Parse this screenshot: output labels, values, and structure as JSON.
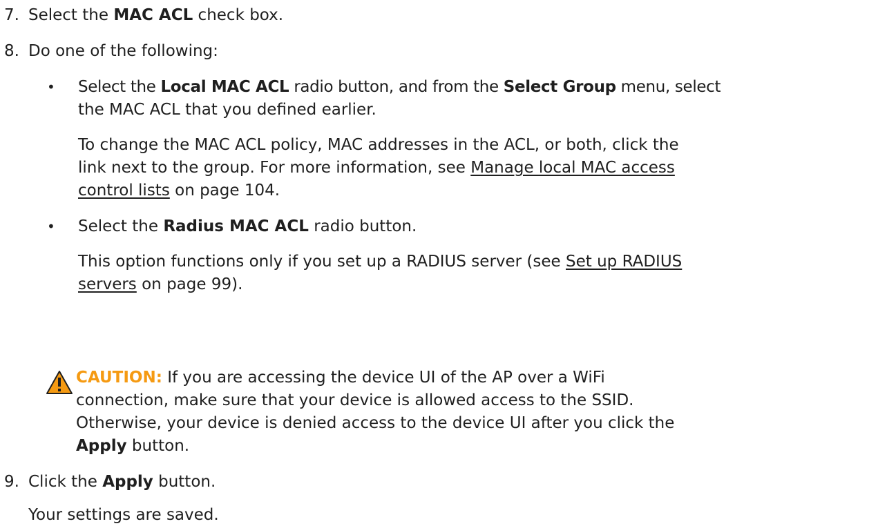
{
  "step7": {
    "number": "7.",
    "pre": "Select the ",
    "bold": "MAC ACL",
    "post": " check box."
  },
  "step8": {
    "number": "8.",
    "text": "Do one of the following:"
  },
  "option1": {
    "bullet": "•",
    "pre": "Select the ",
    "bold1": "Local MAC ACL",
    "mid": " radio button, and from the ",
    "bold2": "Select Group",
    "post": " menu, select",
    "line2": "the MAC ACL that you defined earlier.",
    "para_l1": "To change the MAC ACL policy, MAC addresses in the ACL, or both, click the",
    "para_l2_pre": "link next to the group. For more information, see ",
    "link_part1": "Manage local MAC access",
    "link_part2": "control lists",
    "para_l3_post": " on page 104."
  },
  "option2": {
    "bullet": "•",
    "pre": "Select the ",
    "bold": "Radius MAC ACL",
    "post": " radio button.",
    "para_l1_pre": "This option functions only if you set up a RADIUS server (see ",
    "link_part1": "Set up RADIUS",
    "link_part2": "servers",
    "para_l2_post": " on page 99)."
  },
  "caution": {
    "icon": "warning-triangle-icon",
    "color": "#f59a12",
    "label": "CAUTION:",
    "l1": " If you are accessing the device UI of the AP over a WiFi",
    "l2": "connection, make sure that your device is allowed access to the SSID.",
    "l3": "Otherwise, your device is denied access to the device UI after you click the",
    "bold": "Apply",
    "l4_post": " button."
  },
  "step9": {
    "number": "9.",
    "pre": "Click the ",
    "bold": "Apply",
    "post": " button.",
    "result": "Your settings are saved."
  }
}
